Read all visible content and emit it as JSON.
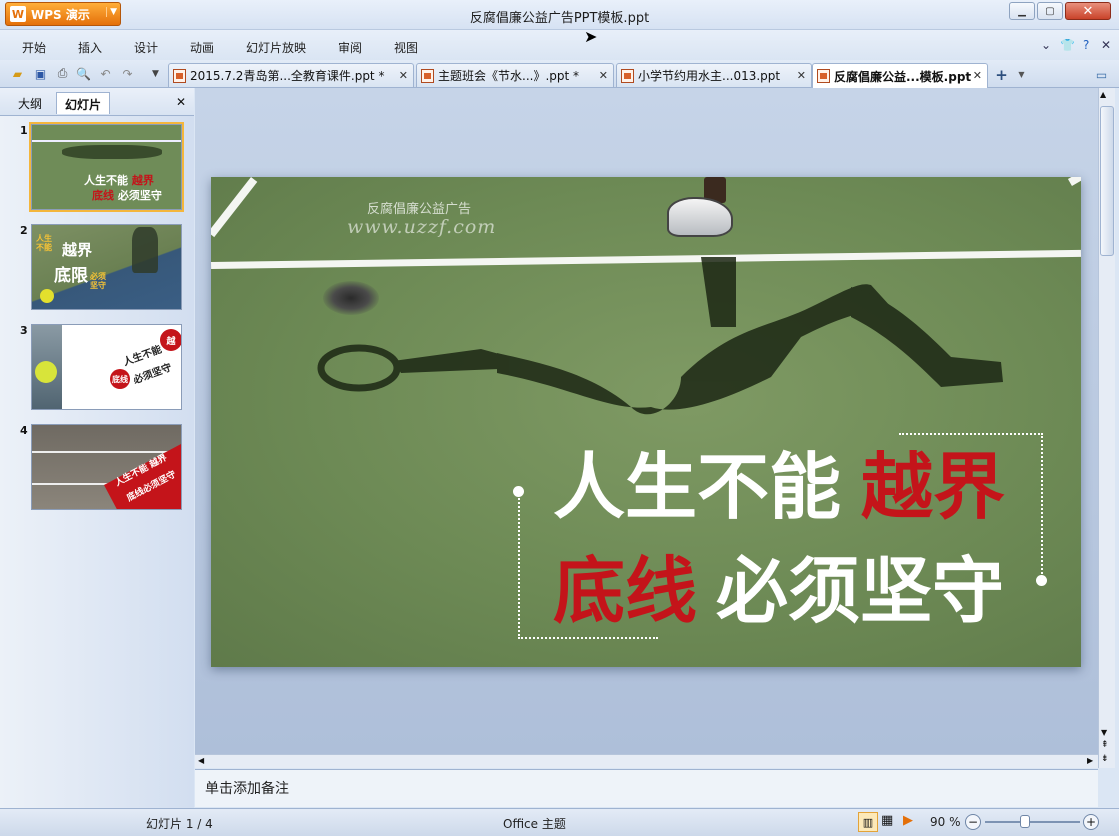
{
  "app": {
    "name": "WPS 演示",
    "doc_title": "反腐倡廉公益广告PPT模板.ppt"
  },
  "menu": [
    "开始",
    "插入",
    "设计",
    "动画",
    "幻灯片放映",
    "审阅",
    "视图"
  ],
  "tabs": [
    {
      "label": "2015.7.2青岛第...全教育课件.ppt *",
      "active": false
    },
    {
      "label": "主题班会《节水...》.ppt *",
      "active": false
    },
    {
      "label": "小学节约用水主...013.ppt",
      "active": false
    },
    {
      "label": "反腐倡廉公益...模板.ppt",
      "active": true
    }
  ],
  "left_pane": {
    "tabs": [
      "大纲",
      "幻灯片"
    ],
    "active_tab": "幻灯片",
    "slides": [
      {
        "num": "1",
        "lines": [
          "人生不能 越界",
          "底线 必须坚守"
        ]
      },
      {
        "num": "2",
        "lines": [
          "人生 不能",
          "越界",
          "底限",
          "必须 坚守"
        ]
      },
      {
        "num": "3",
        "lines": [
          "人生不能",
          "越界",
          "底线",
          "必须坚守"
        ]
      },
      {
        "num": "4",
        "lines": [
          "人生不能 越界",
          "底线必须坚守"
        ]
      }
    ]
  },
  "slide": {
    "watermark_line1": "反腐倡廉公益广告",
    "watermark_line2": "www.uzzf.com",
    "line1_white": "人生不能",
    "line1_red": "越界",
    "line2_red": "底线",
    "line2_white": "必须坚守"
  },
  "notes_placeholder": "单击添加备注",
  "status": {
    "slide_counter": "幻灯片 1 / 4",
    "theme": "Office 主题",
    "zoom": "90 %"
  },
  "colors": {
    "accent_red": "#c4141a",
    "court_green": "#6d8a55",
    "wps_orange": "#e4700a"
  }
}
